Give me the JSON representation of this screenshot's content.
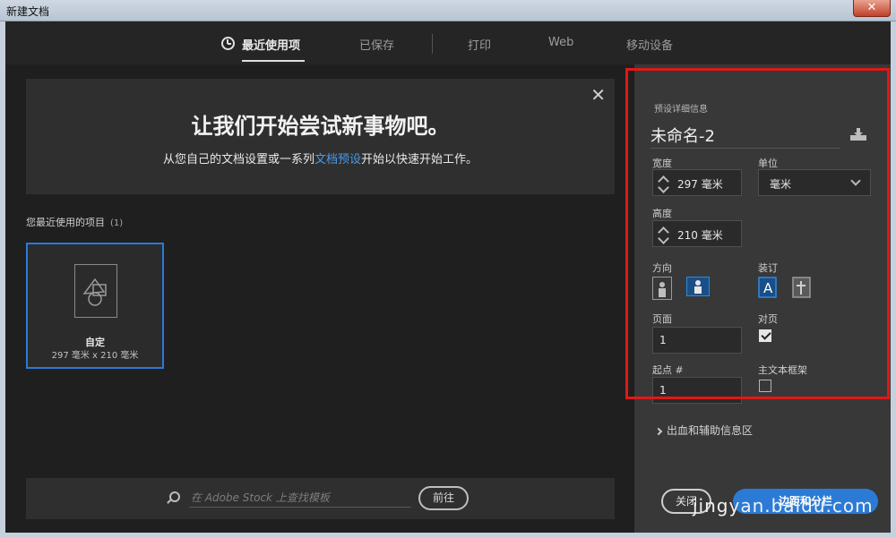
{
  "window": {
    "title": "新建文档",
    "close_glyph": "✕"
  },
  "tabs": [
    {
      "label": "最近使用项",
      "active": true
    },
    {
      "label": "已保存"
    },
    {
      "label": "打印"
    },
    {
      "label": "Web"
    },
    {
      "label": "移动设备"
    }
  ],
  "banner": {
    "title": "让我们开始尝试新事物吧。",
    "sub_before": "从您自己的文档设置或一系列",
    "sub_link": "文档预设",
    "sub_after": "开始以快速开始工作。",
    "close_glyph": "✕"
  },
  "recent": {
    "label": "您最近使用的项目",
    "count": "(1)",
    "items": [
      {
        "name": "自定",
        "size": "297 毫米 x 210 毫米"
      }
    ]
  },
  "search": {
    "placeholder": "在 Adobe Stock 上查找模板",
    "go_label": "前往"
  },
  "preset": {
    "header": "预设详细信息",
    "doc_name": "未命名-2",
    "width_label": "宽度",
    "width_value": "297 毫米",
    "unit_label": "单位",
    "unit_value": "毫米",
    "height_label": "高度",
    "height_value": "210 毫米",
    "orientation_label": "方向",
    "orientation_selected": "landscape",
    "binding_label": "装订",
    "binding_selected": "left-to-right",
    "pages_label": "页面",
    "pages_value": "1",
    "facing_label": "对页",
    "facing_checked": true,
    "start_label": "起点 #",
    "start_value": "1",
    "primary_frame_label": "主文本框架",
    "primary_frame_checked": false
  },
  "bleed_label": "出血和辅助信息区",
  "buttons": {
    "close_label": "关闭",
    "margins_label": "边距和分栏"
  },
  "watermark": "jingyan.baidu.com",
  "colors": {
    "accent": "#2b7bd6",
    "link": "#4b9ae8",
    "highlight": "#e01818"
  }
}
